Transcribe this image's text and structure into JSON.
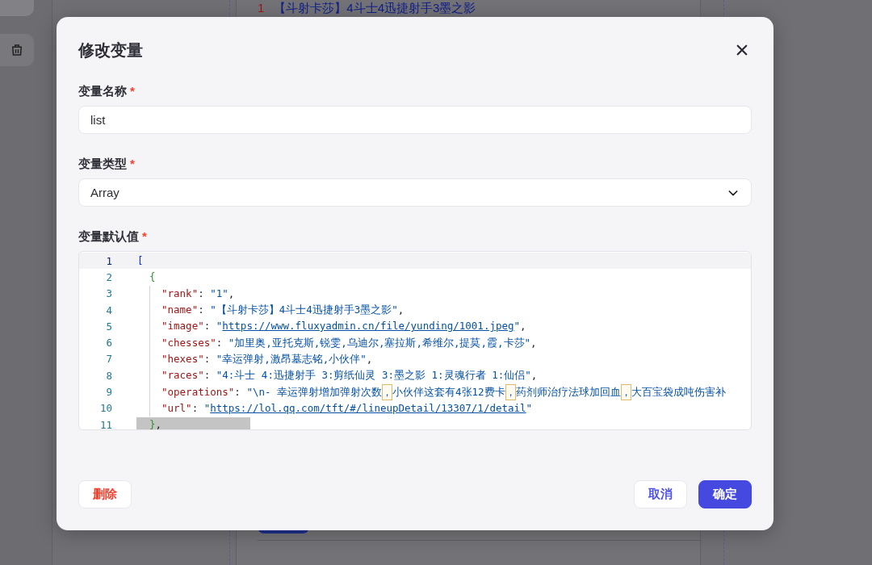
{
  "background": {
    "list_items": [
      {
        "number": "1",
        "text": "【斗射卡莎】4斗士4迅捷射手3墨之影"
      }
    ]
  },
  "dialog": {
    "title": "修改变量",
    "fields": [
      {
        "kind": "text",
        "label": "变量名称",
        "required_mark": "*",
        "value": "list"
      },
      {
        "kind": "select",
        "label": "变量类型",
        "required_mark": "*",
        "value": "Array"
      },
      {
        "kind": "code",
        "label": "变量默认值",
        "required_mark": "*",
        "lines": [
          {
            "number": "1",
            "active": true,
            "tokens": [
              {
                "kind": "bracket",
                "text": "["
              }
            ],
            "children": [
              {
                "number": "2",
                "active": false,
                "tokens": [
                  {
                    "kind": "brace",
                    "text": "{"
                  }
                ],
                "children": [
                  {
                    "number": "3",
                    "active": false,
                    "tokens": [
                      {
                        "kind": "key",
                        "text": "\"rank\""
                      },
                      {
                        "kind": "punct",
                        "text": ": "
                      },
                      {
                        "kind": "string",
                        "text": "\"1\""
                      },
                      {
                        "kind": "punct",
                        "text": ","
                      }
                    ]
                  },
                  {
                    "number": "4",
                    "active": false,
                    "tokens": [
                      {
                        "kind": "key",
                        "text": "\"name\""
                      },
                      {
                        "kind": "punct",
                        "text": ": "
                      },
                      {
                        "kind": "string",
                        "text": "\"【斗射卡莎】4斗士4迅捷射手3墨之影\""
                      },
                      {
                        "kind": "punct",
                        "text": ","
                      }
                    ]
                  },
                  {
                    "number": "5",
                    "active": false,
                    "tokens": [
                      {
                        "kind": "key",
                        "text": "\"image\""
                      },
                      {
                        "kind": "punct",
                        "text": ": "
                      },
                      {
                        "kind": "string",
                        "text": "\""
                      },
                      {
                        "kind": "link",
                        "text": "https://www.fluxyadmin.cn/file/yunding/1001.jpeg"
                      },
                      {
                        "kind": "string",
                        "text": "\""
                      },
                      {
                        "kind": "punct",
                        "text": ","
                      }
                    ]
                  },
                  {
                    "number": "6",
                    "active": false,
                    "tokens": [
                      {
                        "kind": "key",
                        "text": "\"chesses\""
                      },
                      {
                        "kind": "punct",
                        "text": ": "
                      },
                      {
                        "kind": "string",
                        "text": "\"加里奥,亚托克斯,锐雯,乌迪尔,塞拉斯,希维尔,提莫,霞,卡莎\""
                      },
                      {
                        "kind": "punct",
                        "text": ","
                      }
                    ]
                  },
                  {
                    "number": "7",
                    "active": false,
                    "tokens": [
                      {
                        "kind": "key",
                        "text": "\"hexes\""
                      },
                      {
                        "kind": "punct",
                        "text": ": "
                      },
                      {
                        "kind": "string",
                        "text": "\"幸运弹射,激昂墓志铭,小伙伴\""
                      },
                      {
                        "kind": "punct",
                        "text": ","
                      }
                    ]
                  },
                  {
                    "number": "8",
                    "active": false,
                    "tokens": [
                      {
                        "kind": "key",
                        "text": "\"races\""
                      },
                      {
                        "kind": "punct",
                        "text": ": "
                      },
                      {
                        "kind": "string",
                        "text": "\"4:斗士 4:迅捷射手 3:剪纸仙灵 3:墨之影 1:灵魂行者 1:仙侣\""
                      },
                      {
                        "kind": "punct",
                        "text": ","
                      }
                    ]
                  },
                  {
                    "number": "9",
                    "active": false,
                    "tokens": [
                      {
                        "kind": "key",
                        "text": "\"operations\""
                      },
                      {
                        "kind": "punct",
                        "text": ": "
                      },
                      {
                        "kind": "string",
                        "text": "\"\\n- 幸运弹射增加弹射次数"
                      },
                      {
                        "kind": "mark",
                        "text": "，"
                      },
                      {
                        "kind": "string",
                        "text": "小伙伴这套有4张12费卡"
                      },
                      {
                        "kind": "mark",
                        "text": "，"
                      },
                      {
                        "kind": "string",
                        "text": "药剂师治疗法球加回血"
                      },
                      {
                        "kind": "mark",
                        "text": "，"
                      },
                      {
                        "kind": "string",
                        "text": "大百宝袋成吨伤害补"
                      }
                    ]
                  },
                  {
                    "number": "10",
                    "active": false,
                    "tokens": [
                      {
                        "kind": "key",
                        "text": "\"url\""
                      },
                      {
                        "kind": "punct",
                        "text": ": "
                      },
                      {
                        "kind": "string",
                        "text": "\""
                      },
                      {
                        "kind": "link",
                        "text": "https://lol.qq.com/tft/#/lineupDetail/13307/1/detail"
                      },
                      {
                        "kind": "string",
                        "text": "\""
                      }
                    ]
                  }
                ]
              },
              {
                "number": "11",
                "active": false,
                "tail_highlight": true,
                "tokens": [
                  {
                    "kind": "brace",
                    "text": "}"
                  },
                  {
                    "kind": "punct",
                    "text": ","
                  }
                ]
              }
            ]
          }
        ]
      }
    ],
    "buttons": [
      {
        "kind": "danger",
        "label": "删除"
      },
      {
        "kind": "secondary",
        "label": "取消"
      },
      {
        "kind": "primary",
        "label": "确定"
      }
    ]
  }
}
